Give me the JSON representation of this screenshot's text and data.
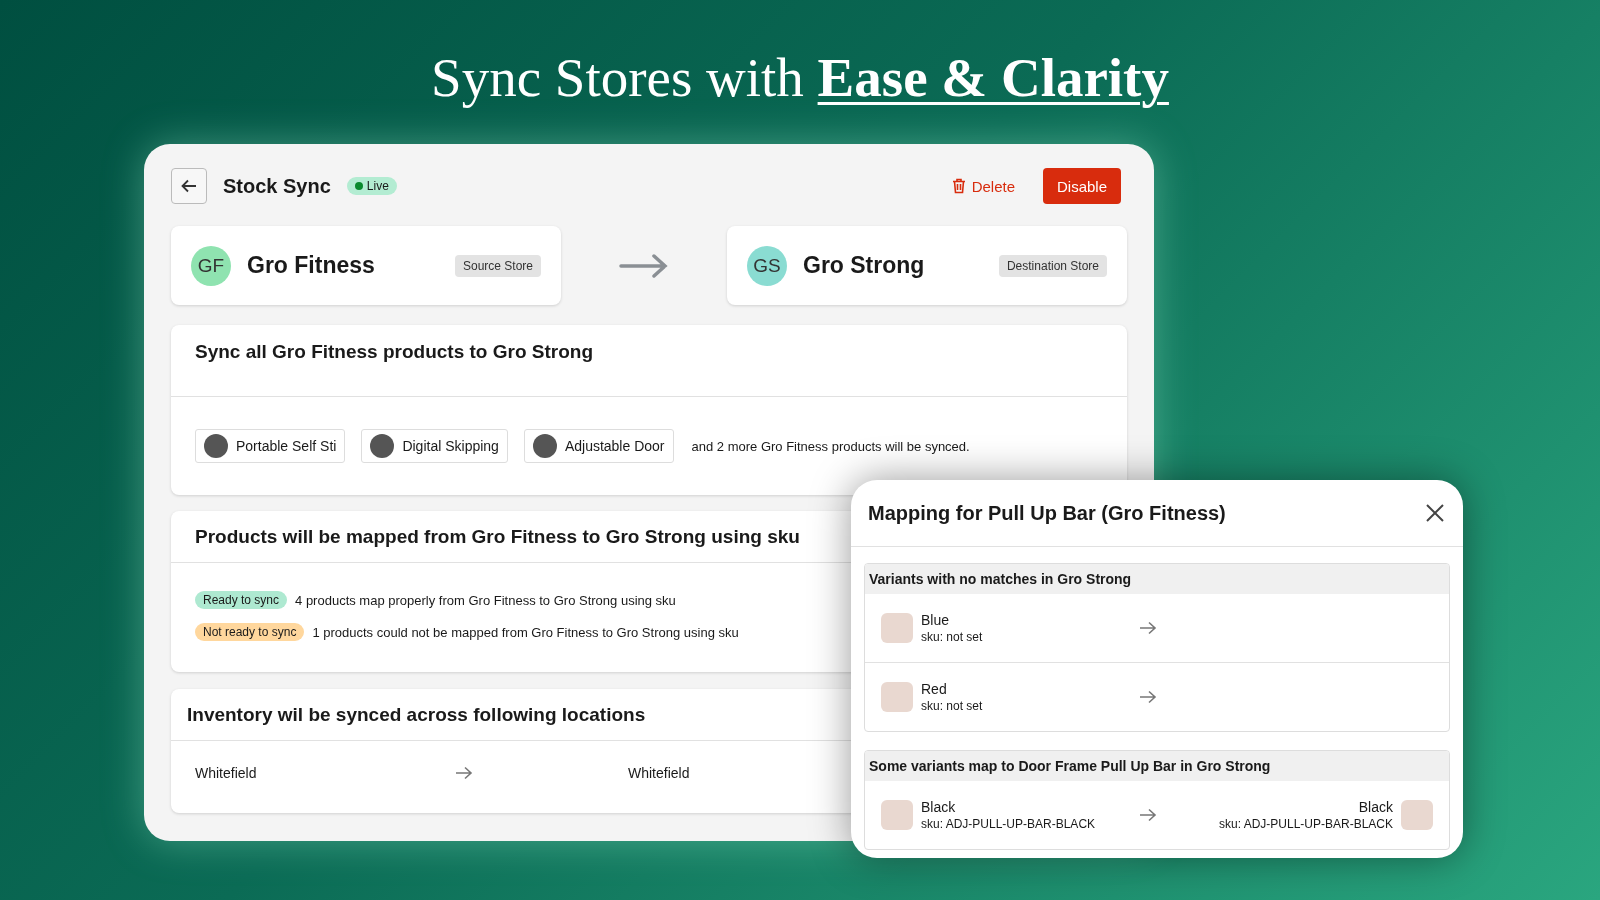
{
  "headline": "Sync Stores with **Ease & Clarity**",
  "header": {
    "title": "Stock Sync",
    "status": {
      "label": "Live",
      "live": true
    },
    "delete": "Delete",
    "disable": "Disable"
  },
  "stores": [
    {
      "initials": "GF",
      "name": "Gro Fitness",
      "role": "Source Store",
      "color": "#8fe3b0"
    },
    {
      "initials": "GS",
      "name": "Gro Strong",
      "role": "Destination Store",
      "color": "#8adcd2"
    }
  ],
  "sync_products": {
    "title": "Sync all Gro Fitness products to Gro Strong",
    "products": [
      {
        "name": "Portable Self Sti"
      },
      {
        "name": "Digital Skipping"
      },
      {
        "name": "Adjustable Door"
      }
    ],
    "more_text": "and 2 more Gro Fitness products will be synced."
  },
  "mapping": {
    "title": "Products will be mapped from Gro Fitness to Gro Strong using sku",
    "statuses": [
      {
        "badge": "Ready to sync",
        "ready": true,
        "text": "4 products map properly from Gro Fitness to Gro Strong using sku"
      },
      {
        "badge": "Not ready to sync",
        "ready": false,
        "text": "1 products could not be mapped from Gro Fitness to Gro Strong using sku"
      }
    ]
  },
  "inventory": {
    "title": "Inventory wil be synced across following locations",
    "locations": [
      {
        "source": "Whitefield",
        "destination": "Whitefield"
      }
    ]
  },
  "dialog": {
    "title": "Mapping for Pull Up Bar (Gro Fitness)",
    "groups": [
      {
        "title": "Variants with no matches in Gro Strong",
        "variants": [
          {
            "name": "Blue",
            "sku": "sku: not set"
          },
          {
            "name": "Red",
            "sku": "sku: not set"
          }
        ]
      },
      {
        "title": "Some variants map to Door Frame Pull Up Bar in Gro Strong",
        "variants": [
          {
            "name": "Black",
            "sku": "sku: ADJ-PULL-UP-BAR-BLACK",
            "match": {
              "name": "Black",
              "sku": "sku: ADJ-PULL-UP-BAR-BLACK"
            }
          }
        ]
      }
    ]
  }
}
